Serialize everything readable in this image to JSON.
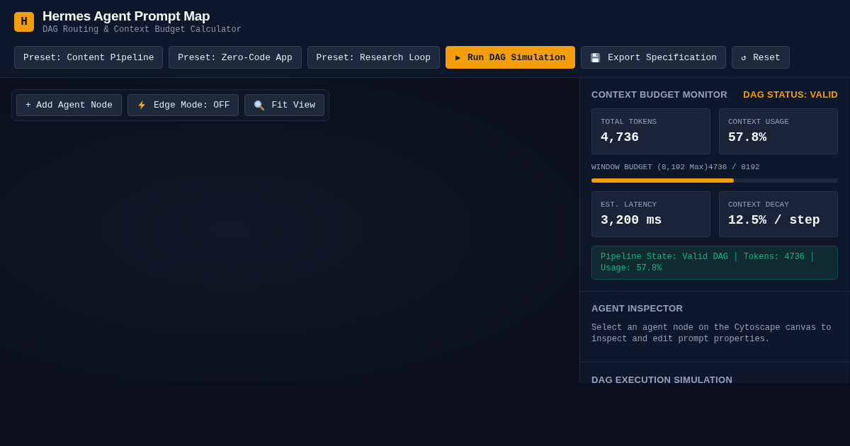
{
  "app": {
    "logo": "H",
    "title": "Hermes Agent Prompt Map",
    "subtitle": "DAG Routing & Context Budget Calculator"
  },
  "toolbar": [
    {
      "label": "Preset: Content Pipeline",
      "kind": "plain"
    },
    {
      "label": "Preset: Zero-Code App",
      "kind": "plain"
    },
    {
      "label": "Preset: Research Loop",
      "kind": "plain"
    },
    {
      "label": "Run DAG Simulation",
      "kind": "primary",
      "icon": "▶"
    },
    {
      "label": "Export Specification",
      "kind": "save"
    },
    {
      "label": "Reset",
      "kind": "plain",
      "icon": "↺"
    }
  ],
  "canvas_toolbar": [
    {
      "label": "+ Add Agent Node",
      "kind": "plain"
    },
    {
      "label": "Edge Mode: OFF",
      "kind": "bolt"
    },
    {
      "label": "Fit View",
      "kind": "search"
    }
  ],
  "budget_monitor": {
    "title": "CONTEXT BUDGET MONITOR",
    "status": "DAG STATUS: VALID",
    "stats": [
      {
        "label": "TOTAL TOKENS",
        "value": "4,736"
      },
      {
        "label": "CONTEXT USAGE",
        "value": "57.8%"
      }
    ],
    "window_budget": {
      "label": "WINDOW BUDGET (8,192 Max)",
      "reading": "4736 / 8192",
      "level": 0.578
    },
    "stats_2": [
      {
        "label": "EST. LATENCY",
        "value": "3,200 ms"
      },
      {
        "label": "CONTEXT DECAY",
        "value": "12.5% / step"
      }
    ],
    "pipeline_state": "Pipeline State: Valid DAG │ Tokens: 4736 │ Usage: 57.8%"
  },
  "agent_inspector": {
    "title": "AGENT INSPECTOR",
    "hint": "Select an agent node on the Cytoscape canvas to inspect and edit prompt properties."
  },
  "simulation": {
    "title": "DAG EXECUTION SIMULATION"
  }
}
